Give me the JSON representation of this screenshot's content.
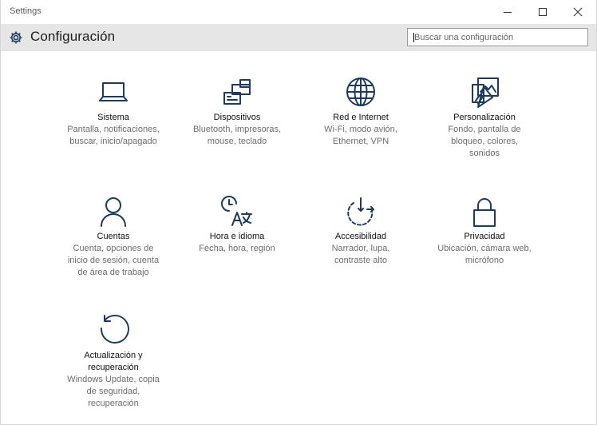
{
  "window": {
    "title": "Settings"
  },
  "header": {
    "title": "Configuración",
    "search_placeholder": "Buscar una configuración"
  },
  "tiles": [
    {
      "name": "Sistema",
      "desc": [
        "Pantalla, notificaciones,",
        "buscar, inicio/apagado"
      ],
      "icon": "laptop-icon"
    },
    {
      "name": "Dispositivos",
      "desc": [
        "Bluetooth, impresoras,",
        "mouse, teclado"
      ],
      "icon": "devices-icon"
    },
    {
      "name": "Red e Internet",
      "desc": [
        "Wi-Fi, modo avión,",
        "Ethernet, VPN"
      ],
      "icon": "globe-icon"
    },
    {
      "name": "Personalización",
      "desc": [
        "Fondo, pantalla de",
        "bloqueo, colores,",
        "sonidos"
      ],
      "icon": "personalization-icon"
    },
    {
      "name": "Cuentas",
      "desc": [
        "Cuenta, opciones de",
        "inicio de sesión, cuenta",
        "de área de trabajo"
      ],
      "icon": "person-icon"
    },
    {
      "name": "Hora e idioma",
      "desc": [
        "Fecha, hora, región"
      ],
      "icon": "time-language-icon"
    },
    {
      "name": "Accesibilidad",
      "desc": [
        "Narrador, lupa,",
        "contraste alto"
      ],
      "icon": "accessibility-icon"
    },
    {
      "name": "Privacidad",
      "desc": [
        "Ubicación, cámara web,",
        "micrófono"
      ],
      "icon": "lock-icon"
    },
    {
      "name": "Actualización y recuperación",
      "name_lines": [
        "Actualización y",
        "recuperación"
      ],
      "desc": [
        "Windows Update, copia",
        "de seguridad,",
        "recuperación"
      ],
      "icon": "update-icon"
    }
  ]
}
